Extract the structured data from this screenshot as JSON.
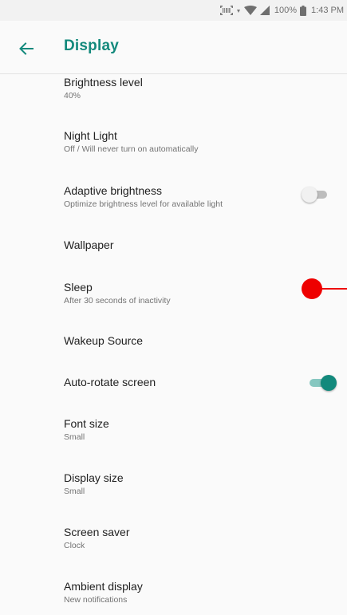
{
  "status_bar": {
    "battery_text": "100%",
    "time": "1:43 PM"
  },
  "toolbar": {
    "title": "Display",
    "back_icon": "arrow-back-icon"
  },
  "colors": {
    "accent": "#13897c",
    "switch_track_on": "#86c7c0",
    "touch_indicator": "#ee0000"
  },
  "settings": [
    {
      "title": "Brightness level",
      "summary": "40%"
    },
    {
      "title": "Night Light",
      "summary": "Off / Will never turn on automatically"
    },
    {
      "title": "Adaptive brightness",
      "summary": "Optimize brightness level for available light",
      "switch": "off"
    },
    {
      "title": "Wallpaper"
    },
    {
      "title": "Sleep",
      "summary": "After 30 seconds of inactivity"
    },
    {
      "title": "Wakeup Source"
    },
    {
      "title": "Auto-rotate screen",
      "switch": "on"
    },
    {
      "title": "Font size",
      "summary": "Small"
    },
    {
      "title": "Display size",
      "summary": "Small"
    },
    {
      "title": "Screen saver",
      "summary": "Clock"
    },
    {
      "title": "Ambient display",
      "summary": "New notifications"
    }
  ]
}
